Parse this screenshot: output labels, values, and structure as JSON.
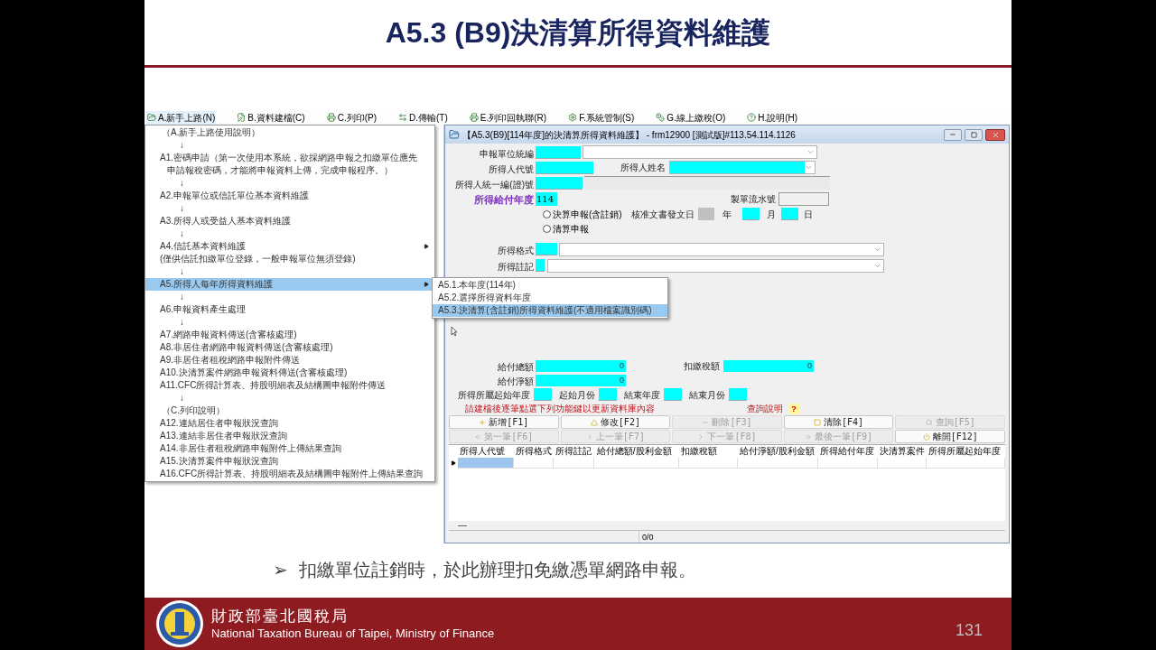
{
  "slide": {
    "title": "A5.3 (B9)決清算所得資料維護",
    "bullet": {
      "marker": "➢",
      "text": "扣繳單位註銷時，於此辦理扣免繳憑單網路申報。"
    },
    "footer": {
      "org_name": "財政部臺北國稅局",
      "org_name_en": "National Taxation Bureau of Taipei, Ministry of Finance",
      "page_number": "131"
    }
  },
  "menubar": [
    {
      "label": "A.新手上路(N)",
      "selected": true
    },
    {
      "label": "B.資料建檔(C)",
      "selected": false
    },
    {
      "label": "C.列印(P)",
      "selected": false
    },
    {
      "label": "D.傳輸(T)",
      "selected": false
    },
    {
      "label": "E.列印回執聯(R)",
      "selected": false
    },
    {
      "label": "F.系統管制(S)",
      "selected": false
    },
    {
      "label": "G.線上繳稅(O)",
      "selected": false
    },
    {
      "label": "H.說明(H)",
      "selected": false
    }
  ],
  "menu": [
    {
      "kind": "header",
      "label": "（A.新手上路使用說明）",
      "selected": false,
      "submenu": false
    },
    {
      "kind": "arrow",
      "label": "↓",
      "selected": false,
      "submenu": false
    },
    {
      "kind": "item",
      "label": "A1.密碼申請（第一次使用本系統，欲採網路申報之扣繳單位應先",
      "selected": false,
      "submenu": false
    },
    {
      "kind": "note",
      "label": "申請報稅密碼，才能將申報資料上傳，完成申報程序。）",
      "selected": false,
      "submenu": false
    },
    {
      "kind": "arrow",
      "label": "↓",
      "selected": false,
      "submenu": false
    },
    {
      "kind": "item",
      "label": "A2.申報單位或信託單位基本資料維護",
      "selected": false,
      "submenu": false
    },
    {
      "kind": "arrow",
      "label": "↓",
      "selected": false,
      "submenu": false
    },
    {
      "kind": "item",
      "label": "A3.所得人或受益人基本資料維護",
      "selected": false,
      "submenu": false
    },
    {
      "kind": "arrow",
      "label": "↓",
      "selected": false,
      "submenu": false
    },
    {
      "kind": "item",
      "label": "A4.信託基本資料維護",
      "selected": false,
      "submenu": true
    },
    {
      "kind": "item",
      "label": "(僅供信託扣繳單位登錄，一般申報單位無須登錄)",
      "selected": false,
      "submenu": false
    },
    {
      "kind": "arrow",
      "label": "↓",
      "selected": false,
      "submenu": false
    },
    {
      "kind": "item",
      "label": "A5.所得人每年所得資料維護",
      "selected": true,
      "submenu": true
    },
    {
      "kind": "arrow",
      "label": "↓",
      "selected": false,
      "submenu": false
    },
    {
      "kind": "item",
      "label": "A6.申報資料產生處理",
      "selected": false,
      "submenu": false
    },
    {
      "kind": "arrow",
      "label": "↓",
      "selected": false,
      "submenu": false
    },
    {
      "kind": "item",
      "label": "A7.網路申報資料傳送(含審核處理)",
      "selected": false,
      "submenu": false
    },
    {
      "kind": "item",
      "label": "A8.非居住者網路申報資料傳送(含審核處理)",
      "selected": false,
      "submenu": false
    },
    {
      "kind": "item",
      "label": "A9.非居住者租稅網路申報附件傳送",
      "selected": false,
      "submenu": false
    },
    {
      "kind": "item",
      "label": "A10.決清算案件網路申報資料傳送(含審核處理)",
      "selected": false,
      "submenu": false
    },
    {
      "kind": "item",
      "label": "A11.CFC所得計算表、持股明細表及結構圖申報附件傳送",
      "selected": false,
      "submenu": false
    },
    {
      "kind": "arrow",
      "label": "↓",
      "selected": false,
      "submenu": false
    },
    {
      "kind": "header",
      "label": "（C.列印說明）",
      "selected": false,
      "submenu": false
    },
    {
      "kind": "item",
      "label": "A12.連結居住者申報狀況查詢",
      "selected": false,
      "submenu": false
    },
    {
      "kind": "item",
      "label": "A13.連結非居住者申報狀況查詢",
      "selected": false,
      "submenu": false
    },
    {
      "kind": "item",
      "label": "A14.非居住者租稅網路申報附件上傳結果查詢",
      "selected": false,
      "submenu": false
    },
    {
      "kind": "item",
      "label": "A15.決清算案件申報狀況查詢",
      "selected": false,
      "submenu": false
    },
    {
      "kind": "item",
      "label": "A16.CFC所得計算表、持股明細表及結構圖申報附件上傳結果查詢",
      "selected": false,
      "submenu": false
    }
  ],
  "submenu": [
    {
      "label": "A5.1.本年度(114年)",
      "selected": false
    },
    {
      "label": "A5.2.選擇所得資料年度",
      "selected": false
    },
    {
      "label": "A5.3.決清算(含註銷)所得資料維護(不適用檔案識別碼)",
      "selected": true
    }
  ],
  "window": {
    "title": "【A5.3(B9)[114年度]的決清算所得資料維護】 - frm12900 [測試版]#113.54.114.1126"
  },
  "form": {
    "unit_id_label": "申報單位統編",
    "payee_code_label": "所得人代號",
    "payee_name_label": "所得人姓名",
    "payee_id_label": "所得人統一編(證)號",
    "pay_year": {
      "label": "所得給付年度",
      "value": "114"
    },
    "serial_label": "製單流水號",
    "filing_types": [
      {
        "label": "決算申報(含註銷)",
        "selected": false
      },
      {
        "label": "清算申報",
        "selected": false
      }
    ],
    "approval_date": {
      "label": "核准文書發文日",
      "year_label": "年",
      "month_label": "月",
      "day_label": "日"
    },
    "income_format_label": "所得格式",
    "income_note_label": "所得註記",
    "amounts": [
      {
        "label": "給付總額",
        "value": "0"
      },
      {
        "label": "扣繳稅額",
        "value": "0"
      },
      {
        "label": "給付淨額",
        "value": "0"
      }
    ],
    "period_labels": [
      "所得所屬起始年度",
      "起始月份",
      "結束年度",
      "結束月份"
    ],
    "notice": "請建檔後逐筆點選下列功能鍵以更新資料庫內容",
    "help_label": "查詢說明",
    "help_icon": "?"
  },
  "buttons": [
    {
      "label": "新增[F1]",
      "disabled": false
    },
    {
      "label": "修改[F2]",
      "disabled": false
    },
    {
      "label": "刪除[F3]",
      "disabled": true
    },
    {
      "label": "清除[F4]",
      "disabled": false
    },
    {
      "label": "查詢[F5]",
      "disabled": true
    },
    {
      "label": "第一筆[F6]",
      "disabled": true
    },
    {
      "label": "上一筆[F7]",
      "disabled": true
    },
    {
      "label": "下一筆[F8]",
      "disabled": true
    },
    {
      "label": "最後一筆[F9]",
      "disabled": true
    },
    {
      "label": "離開[F12]",
      "disabled": false
    }
  ],
  "grid": {
    "columns": [
      "所得人代號",
      "所得格式",
      "所得註記",
      "給付總額/股利金額",
      "扣繳稅額",
      "給付淨額/股利金額",
      "所得給付年度",
      "決清算案件",
      "所得所屬起始年度"
    ]
  },
  "status_bar": {
    "record_count": "0/0"
  }
}
